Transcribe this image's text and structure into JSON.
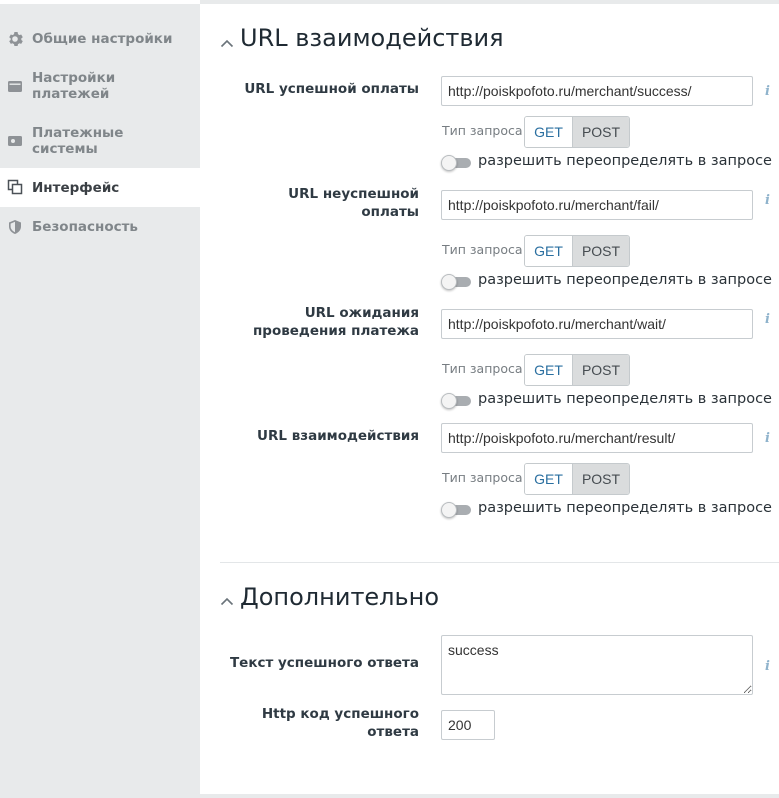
{
  "sidebar": {
    "items": [
      {
        "label": "Общие настройки",
        "icon": "gear-icon"
      },
      {
        "label": "Настройки\nплатежей",
        "icon": "wallet-icon"
      },
      {
        "label": "Платежные\nсистемы",
        "icon": "card-icon"
      },
      {
        "label": "Интерфейс",
        "icon": "windows-icon",
        "active": true
      },
      {
        "label": "Безопасность",
        "icon": "shield-icon"
      }
    ]
  },
  "section_url": {
    "title": "URL взаимодействия",
    "request_type_label": "Тип запроса",
    "get_label": "GET",
    "post_label": "POST",
    "override_label": "разрешить переопределять в запросе",
    "fields": [
      {
        "label": "URL успешной оплаты",
        "value": "http://poiskpofoto.ru/merchant/success/",
        "method": "POST",
        "override": false
      },
      {
        "label": "URL неуспешной\nоплаты",
        "value": "http://poiskpofoto.ru/merchant/fail/",
        "method": "POST",
        "override": false
      },
      {
        "label": "URL ожидания\nпроведения платежа",
        "value": "http://poiskpofoto.ru/merchant/wait/",
        "method": "POST",
        "override": false
      },
      {
        "label": "URL взаимодействия",
        "value": "http://poiskpofoto.ru/merchant/result/",
        "method": "POST",
        "override": false
      }
    ]
  },
  "section_extra": {
    "title": "Дополнительно",
    "success_text_label": "Текст успешного ответа",
    "success_text_value": "success",
    "http_code_label": "Http код успешного\nответа",
    "http_code_value": "200"
  },
  "colors": {
    "sidebar_bg": "#e8eaeb",
    "active_bg": "#ffffff",
    "get_text": "#2a6fa0",
    "post_active_bg": "#dadcdd",
    "info_icon": "#8fb3cc"
  }
}
